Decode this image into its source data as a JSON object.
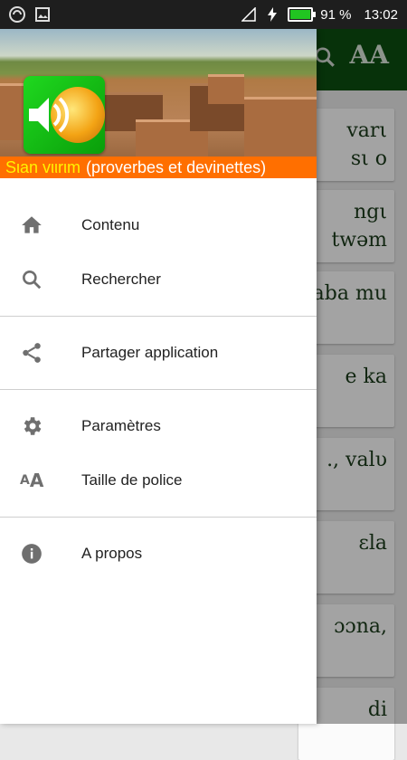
{
  "status_bar": {
    "battery_percent": "91 %",
    "time": "13:02",
    "icons": [
      "app-logo-icon",
      "image-icon",
      "signal-icon",
      "charging-icon",
      "battery-icon"
    ],
    "battery_level": 0.91
  },
  "app_toolbar": {
    "icons": [
      "search-icon",
      "font-size-icon"
    ],
    "font_icon_text": "AA",
    "color": "#0b4d10"
  },
  "background_cards": [
    {
      "text": "varι\nsι o"
    },
    {
      "text": "ngι\ntwəm"
    },
    {
      "text": "aba mu"
    },
    {
      "text": "e ka"
    },
    {
      "text": "., valυ"
    },
    {
      "text": "εla"
    },
    {
      "text": "ɔɔna,"
    },
    {
      "text": "di"
    }
  ],
  "drawer": {
    "header": {
      "app_title_part1": "Sιan vιιrιm",
      "app_title_part2": "(proverbes et devinettes)",
      "title_bar_color": "#ff6f00"
    },
    "groups": [
      [
        {
          "label": "Contenu",
          "icon": "home-icon"
        },
        {
          "label": "Rechercher",
          "icon": "search-icon"
        }
      ],
      [
        {
          "label": "Partager application",
          "icon": "share-icon"
        }
      ],
      [
        {
          "label": "Paramètres",
          "icon": "gear-icon"
        },
        {
          "label": "Taille de police",
          "icon": "font-size-icon"
        }
      ],
      [
        {
          "label": "A propos",
          "icon": "info-icon"
        }
      ]
    ]
  }
}
